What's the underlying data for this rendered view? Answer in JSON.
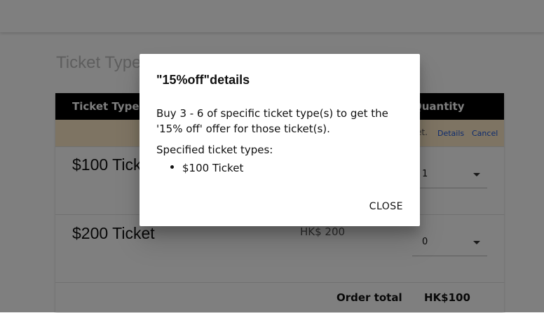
{
  "page": {
    "heading": "Ticket Type"
  },
  "table": {
    "headers": {
      "ticket_type": "Ticket Type",
      "quantity": "Quantity"
    },
    "promo": {
      "text": "et.",
      "details_label": "Details",
      "cancel_label": "Cancel"
    },
    "rows": [
      {
        "name": "$100 Ticket",
        "price": "",
        "quantity": "1"
      },
      {
        "name": "$200 Ticket",
        "price": "HK$ 200",
        "quantity": "0"
      }
    ],
    "total": {
      "label": "Order total",
      "value": "HK$100"
    }
  },
  "dialog": {
    "title": "\"15%off\"details",
    "body": "Buy 3 - 6 of specific ticket type(s) to get the '15% off' offer for those ticket(s).",
    "specified_label": "Specified ticket types:",
    "ticket_types": [
      "$100 Ticket"
    ],
    "close_label": "CLOSE"
  },
  "colors": {
    "header_bg": "#000000",
    "promo_bg": "#fde9c7",
    "link": "#1a56db",
    "overlay": "rgba(0,0,0,0.5)"
  }
}
